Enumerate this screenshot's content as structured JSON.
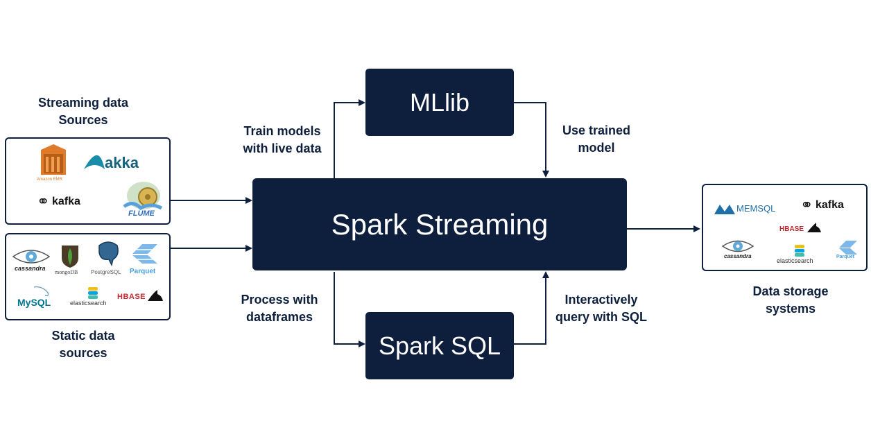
{
  "nodes": {
    "mllib": "MLlib",
    "spark_streaming": "Spark Streaming",
    "spark_sql": "Spark SQL"
  },
  "labels": {
    "streaming_sources": [
      "Streaming data",
      "Sources"
    ],
    "static_sources": [
      "Static data",
      "sources"
    ],
    "storage": [
      "Data storage",
      "systems"
    ],
    "train": [
      "Train models",
      "with live data"
    ],
    "use_model": [
      "Use trained",
      "model"
    ],
    "process": [
      "Process with",
      "dataframes"
    ],
    "query": [
      "Interactively",
      "query with SQL"
    ]
  },
  "streaming_logos": {
    "emr": "Amazon EMR",
    "akka": "akka",
    "kafka": "kafka",
    "flume": "FLUME"
  },
  "static_logos": {
    "cassandra": "cassandra",
    "mongodb": "mongoDB",
    "postgresql": "PostgreSQL",
    "parquet": "Parquet",
    "mysql": "MySQL",
    "elasticsearch": "elasticsearch",
    "hbase": "HBASE"
  },
  "storage_logos": {
    "memsql": "MEMSQL",
    "kafka": "kafka",
    "hbase": "HBASE",
    "cassandra": "cassandra",
    "elasticsearch": "elasticsearch",
    "parquet": "Parquet"
  },
  "colors": {
    "navy": "#0e1f3e",
    "emr_orange": "#e07b2a",
    "akka_teal": "#1a8ca8",
    "parquet_blue": "#4a9ee0",
    "mysql_blue": "#00758f",
    "mysql_orange": "#f29111",
    "hbase_red": "#c4262e",
    "mongo_green": "#4f9e3a"
  }
}
